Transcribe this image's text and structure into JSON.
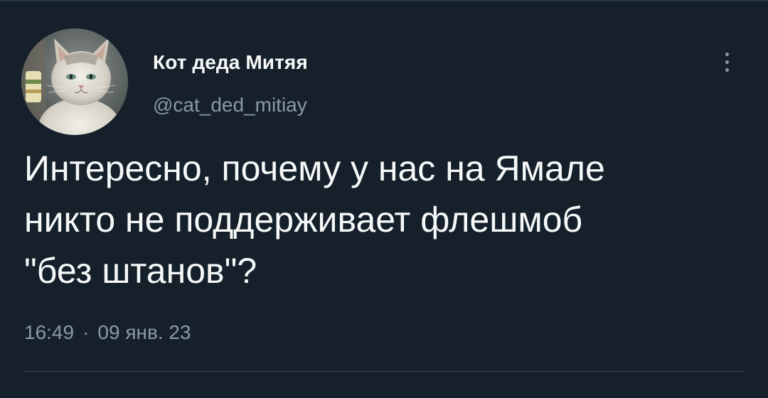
{
  "author": {
    "display_name": "Кот деда Митяя",
    "handle": "@cat_ded_mitiay"
  },
  "tweet": {
    "lines": [
      "Интересно, почему у нас на Ямале",
      "никто не поддерживает флешмоб",
      "\"без штанов\"?"
    ],
    "time": "16:49",
    "separator": "·",
    "date": "09 янв. 23"
  },
  "icons": {
    "more": "more-options-icon",
    "avatar": "cat-avatar"
  },
  "colors": {
    "background": "#15202b",
    "text": "#f7f9f9",
    "secondary_text": "#8b98a5",
    "divider": "#38444d"
  }
}
